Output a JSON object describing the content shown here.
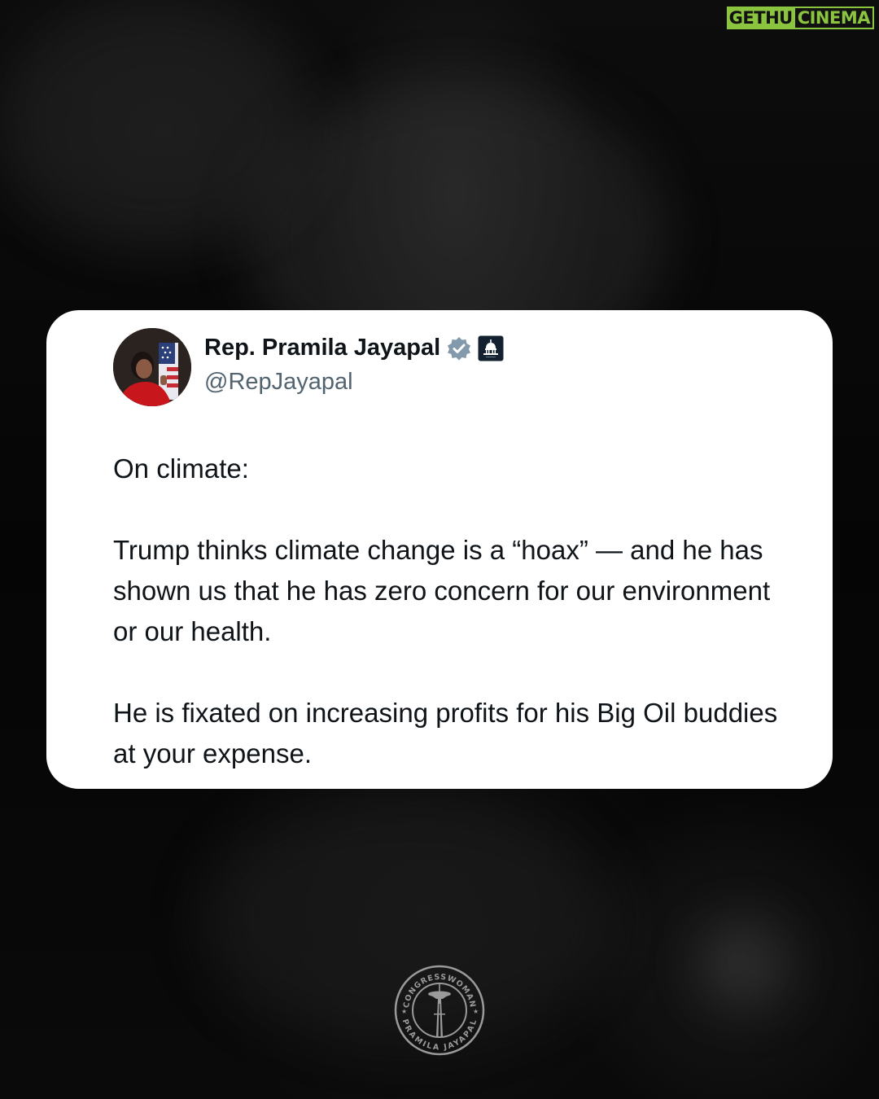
{
  "watermark": {
    "part_a": "GETHU",
    "part_b": "CINEMA",
    "accent_color": "#8bc53f"
  },
  "tweet": {
    "author_name": "Rep. Pramila Jayapal",
    "handle": "@RepJayapal",
    "verified_icon": "verified-badge-icon",
    "affiliation_icon": "capitol-dome-icon",
    "paragraphs": [
      "On climate:",
      "Trump thinks climate change is a “hoax” — and he has shown us that he has zero concern for our environment or our health.",
      "He is fixated on increasing profits for his Big Oil buddies at your expense."
    ]
  },
  "footer_logo": {
    "top_text": "CONGRESSWOMAN",
    "bottom_text": "PRAMILA JAYAPAL",
    "icon": "space-needle-seal-icon"
  }
}
